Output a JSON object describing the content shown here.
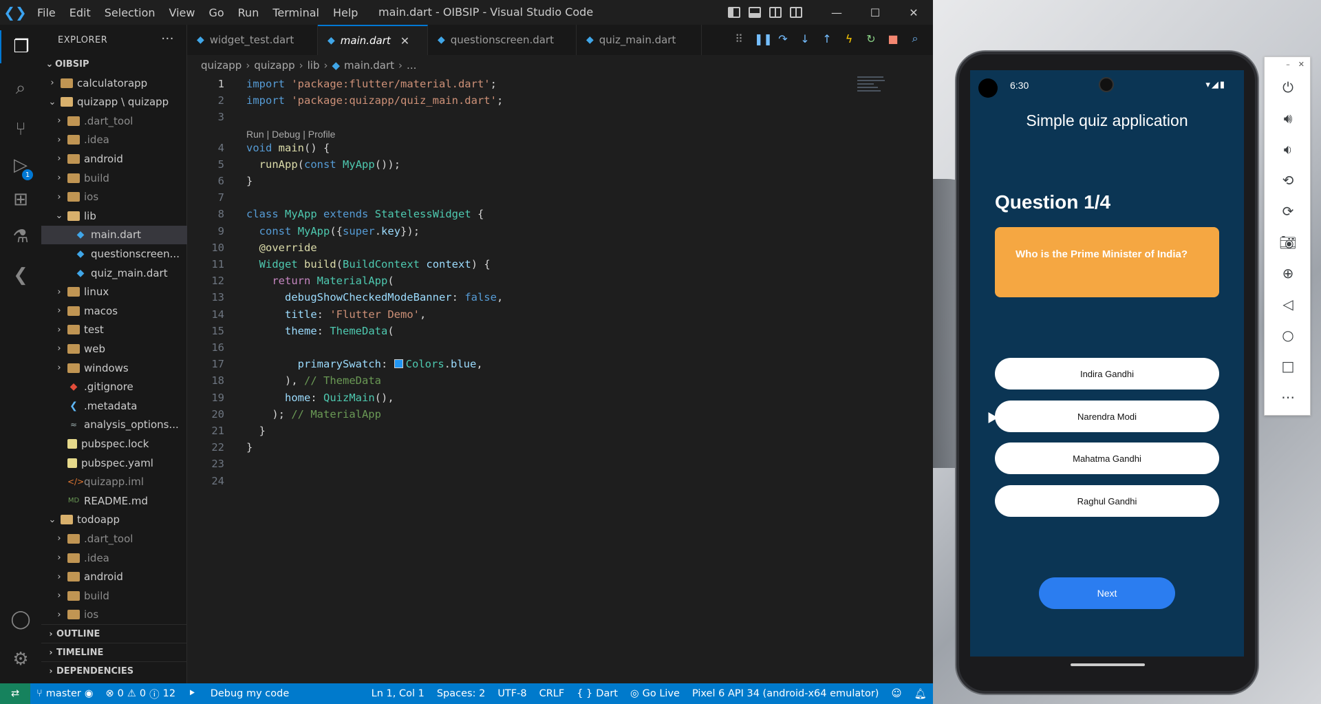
{
  "window": {
    "title": "main.dart - OIBSIP - Visual Studio Code",
    "menu": [
      "File",
      "Edit",
      "Selection",
      "View",
      "Go",
      "Run",
      "Terminal",
      "Help"
    ]
  },
  "explorer": {
    "header": "EXPLORER",
    "root": "OIBSIP",
    "items": [
      {
        "label": "calculatorapp",
        "kind": "folder"
      },
      {
        "label": "quizapp \\ quizapp",
        "kind": "folder-open"
      },
      {
        "label": ".dart_tool",
        "kind": "folder"
      },
      {
        "label": ".idea",
        "kind": "folder"
      },
      {
        "label": "android",
        "kind": "folder"
      },
      {
        "label": "build",
        "kind": "folder"
      },
      {
        "label": "ios",
        "kind": "folder"
      },
      {
        "label": "lib",
        "kind": "folder-open"
      },
      {
        "label": "main.dart",
        "kind": "dart"
      },
      {
        "label": "questionscreen...",
        "kind": "dart"
      },
      {
        "label": "quiz_main.dart",
        "kind": "dart"
      },
      {
        "label": "linux",
        "kind": "folder"
      },
      {
        "label": "macos",
        "kind": "folder"
      },
      {
        "label": "test",
        "kind": "folder"
      },
      {
        "label": "web",
        "kind": "folder"
      },
      {
        "label": "windows",
        "kind": "folder"
      },
      {
        "label": ".gitignore",
        "kind": "git"
      },
      {
        "label": ".metadata",
        "kind": "flutter"
      },
      {
        "label": "analysis_options...",
        "kind": "analysis"
      },
      {
        "label": "pubspec.lock",
        "kind": "lock"
      },
      {
        "label": "pubspec.yaml",
        "kind": "yaml"
      },
      {
        "label": "quizapp.iml",
        "kind": "xml"
      },
      {
        "label": "README.md",
        "kind": "md"
      },
      {
        "label": "todoapp",
        "kind": "folder-open"
      },
      {
        "label": ".dart_tool",
        "kind": "folder"
      },
      {
        "label": ".idea",
        "kind": "folder"
      },
      {
        "label": "android",
        "kind": "folder"
      },
      {
        "label": "build",
        "kind": "folder"
      },
      {
        "label": "ios",
        "kind": "folder"
      }
    ],
    "sections": [
      "OUTLINE",
      "TIMELINE",
      "DEPENDENCIES"
    ]
  },
  "tabs": [
    {
      "label": "widget_test.dart"
    },
    {
      "label": "main.dart"
    },
    {
      "label": "questionscreen.dart"
    },
    {
      "label": "quiz_main.dart"
    }
  ],
  "breadcrumb": [
    "quizapp",
    "quizapp",
    "lib",
    "main.dart",
    "..."
  ],
  "code": {
    "codelens": "Run | Debug | Profile",
    "lines": [
      "import 'package:flutter/material.dart';",
      "import 'package:quizapp/quiz_main.dart';",
      "",
      "void main() {",
      "  runApp(const MyApp());",
      "}",
      "",
      "class MyApp extends StatelessWidget {",
      "  const MyApp({super.key});",
      "  @override",
      "  Widget build(BuildContext context) {",
      "    return MaterialApp(",
      "      debugShowCheckedModeBanner: false,",
      "      title: 'Flutter Demo',",
      "      theme: ThemeData(",
      "",
      "        primarySwatch: Colors.blue,",
      "      ), // ThemeData",
      "      home: QuizMain(),",
      "    ); // MaterialApp",
      "  }",
      "}",
      "",
      ""
    ]
  },
  "statusbar": {
    "branch": "master",
    "problems": "0",
    "warnings": "0",
    "info": "12",
    "debug": "Debug my code",
    "position": "Ln 1, Col 1",
    "spaces": "Spaces: 2",
    "encoding": "UTF-8",
    "eol": "CRLF",
    "language": "Dart",
    "golive": "Go Live",
    "device": "Pixel 6 API 34 (android-x64 emulator)"
  },
  "phone": {
    "time": "6:30",
    "app_title": "Simple quiz application",
    "question_number": "Question 1/4",
    "question": "Who is the Prime Minister of India?",
    "answers": [
      "Indira Gandhi",
      "Narendra Modi",
      "Mahatma Gandhi",
      "Raghul Gandhi"
    ],
    "next_label": "Next",
    "colors": {
      "background": "#0b3554",
      "question_card": "#f5a742",
      "next_button": "#2b7df0"
    }
  }
}
